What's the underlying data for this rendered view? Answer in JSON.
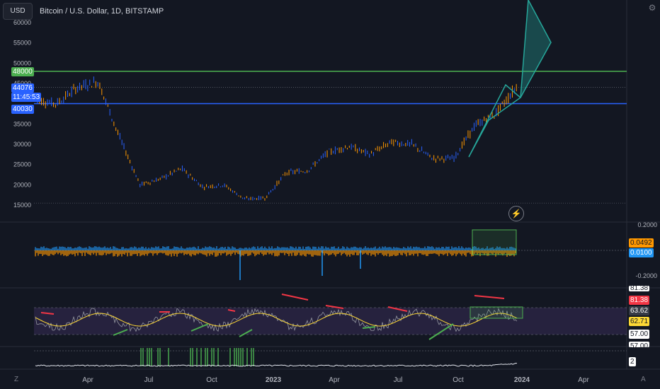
{
  "header": {
    "currency_button": "USD",
    "title": "Bitcoin / U.S. Dollar, 1D, BITSTAMP"
  },
  "price_pane": {
    "y_ticks": [
      "60000",
      "55000",
      "50000",
      "45000",
      "35000",
      "30000",
      "25000",
      "20000",
      "15000"
    ],
    "labels": {
      "level_48000": "48000",
      "last_price": "44076",
      "countdown": "11:45:53",
      "level_40030": "40030"
    },
    "colors": {
      "green_level": "#4caf50",
      "blue_level": "#2962ff",
      "up": "#2962ff",
      "down": "#ff9800"
    }
  },
  "osc_pane_1": {
    "y_ticks": [
      "0.2000",
      "-0.2000"
    ],
    "labels": {
      "value_a": "0.0492",
      "value_b": "0.0100"
    }
  },
  "osc_pane_2": {
    "y_ticks": [
      "81.38",
      "63.62",
      "62.71",
      "57.00",
      "57.00"
    ],
    "labels": {
      "top_partial": "81.38",
      "a": "81.38",
      "b": "63.62",
      "c": "62.71",
      "d": "57.00",
      "e": "57.00"
    }
  },
  "osc_pane_3": {
    "labels": {
      "value": "2"
    }
  },
  "x_axis": {
    "ticks": [
      "Apr",
      "Jul",
      "Oct",
      "2023",
      "Apr",
      "Jul",
      "Oct",
      "2024",
      "Apr"
    ],
    "left_button": "Z",
    "right_button": "A"
  },
  "chart_data": {
    "type": "line",
    "title": "Bitcoin / U.S. Dollar, 1D, BITSTAMP",
    "xlabel": "",
    "ylabel": "",
    "ylim": [
      14000,
      62000
    ],
    "x": [
      "2022-01",
      "2022-02",
      "2022-03",
      "2022-04",
      "2022-05",
      "2022-06",
      "2022-07",
      "2022-08",
      "2022-09",
      "2022-10",
      "2022-11",
      "2022-12",
      "2023-01",
      "2023-02",
      "2023-03",
      "2023-04",
      "2023-05",
      "2023-06",
      "2023-07",
      "2023-08",
      "2023-09",
      "2023-10",
      "2023-11",
      "2023-12"
    ],
    "series": [
      {
        "values": [
          41000,
          40000,
          44000,
          45500,
          32000,
          20000,
          21500,
          24000,
          19500,
          20000,
          16500,
          16800,
          23000,
          23500,
          28000,
          29500,
          27500,
          30500,
          30000,
          26500,
          26500,
          34500,
          37500,
          44076
        ]
      }
    ],
    "horizontal_levels": [
      48000,
      40030
    ],
    "last_price": 44076
  }
}
